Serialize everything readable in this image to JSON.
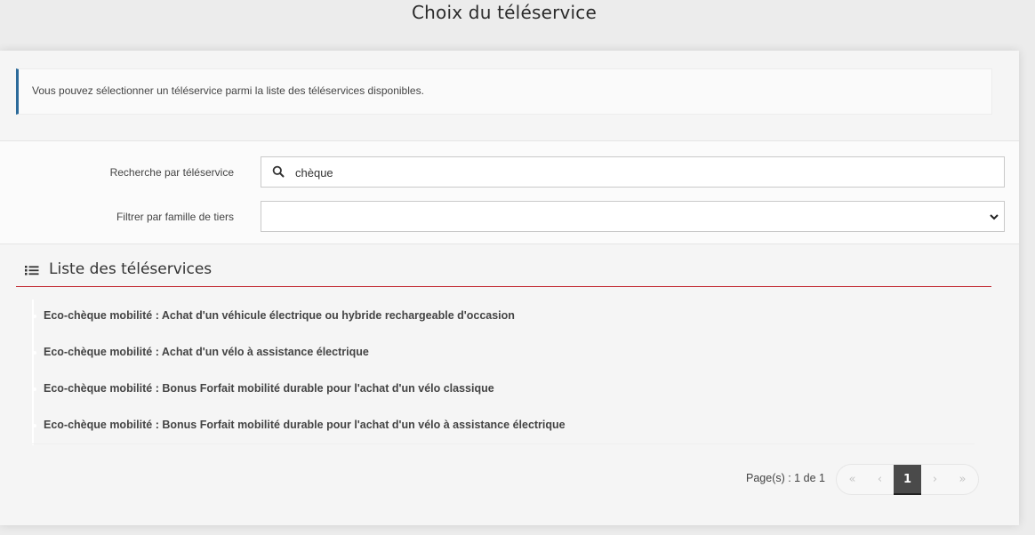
{
  "page": {
    "title": "Choix du téléservice"
  },
  "info": {
    "text": "Vous pouvez sélectionner un téléservice parmi la liste des téléservices disponibles."
  },
  "search": {
    "label": "Recherche par téléservice",
    "value": "chèque"
  },
  "filter": {
    "label": "Filtrer par famille de tiers",
    "value": ""
  },
  "list": {
    "title": "Liste des téléservices",
    "items": [
      "Eco-chèque mobilité : Achat d'un véhicule électrique ou hybride rechargeable d'occasion",
      "Eco-chèque mobilité : Achat d'un vélo à assistance électrique",
      "Eco-chèque mobilité : Bonus Forfait mobilité durable pour l'achat d'un vélo classique",
      "Eco-chèque mobilité : Bonus Forfait mobilité durable pour l'achat d'un vélo à assistance électrique"
    ]
  },
  "pagination": {
    "text": "Page(s) : 1 de 1",
    "first": "«",
    "prev": "‹",
    "current": "1",
    "next": "›",
    "last": "»"
  },
  "colors": {
    "accent_line": "#c0202a",
    "info_border": "#2b6a9a",
    "active_page": "#4a4a4a"
  }
}
